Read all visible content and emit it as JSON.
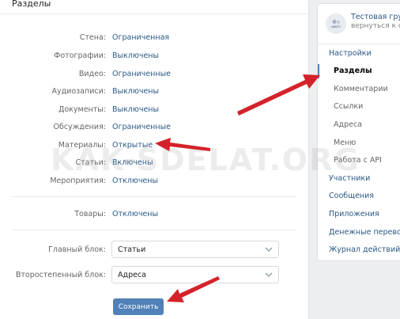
{
  "section_title": "Разделы",
  "sections": [
    {
      "label": "Стена:",
      "value": "Ограниченная"
    },
    {
      "label": "Фотографии:",
      "value": "Выключены"
    },
    {
      "label": "Видео:",
      "value": "Ограниченные"
    },
    {
      "label": "Аудиозаписи:",
      "value": "Выключены"
    },
    {
      "label": "Документы:",
      "value": "Выключены"
    },
    {
      "label": "Обсуждения:",
      "value": "Ограниченные"
    },
    {
      "label": "Материалы:",
      "value": "Открытые"
    },
    {
      "label": "Статьи:",
      "value": "Включены"
    },
    {
      "label": "Мероприятия:",
      "value": "Отключены"
    }
  ],
  "goods": {
    "label": "Товары:",
    "value": "Отключены"
  },
  "main_block": {
    "label": "Главный блок:",
    "value": "Статьи"
  },
  "secondary_block": {
    "label": "Второстепенный блок:",
    "value": "Адреса"
  },
  "save_label": "Сохранить",
  "group": {
    "name": "Тестовая групп",
    "back_link": "вернуться к ст"
  },
  "menu": {
    "settings": "Настройки",
    "sections": "Разделы",
    "comments": "Комментарии",
    "links": "Ссылки",
    "addresses": "Адреса",
    "menu": "Меню",
    "api": "Работа с API",
    "members": "Участники",
    "messages": "Сообщения",
    "apps": "Приложения",
    "money": "Денежные переводы",
    "log": "Журнал действий"
  },
  "watermark": "KAK-SDELAT.ORG",
  "colors": {
    "link": "#2a5885",
    "button": "#5181b8",
    "arrow": "#d4222a"
  }
}
